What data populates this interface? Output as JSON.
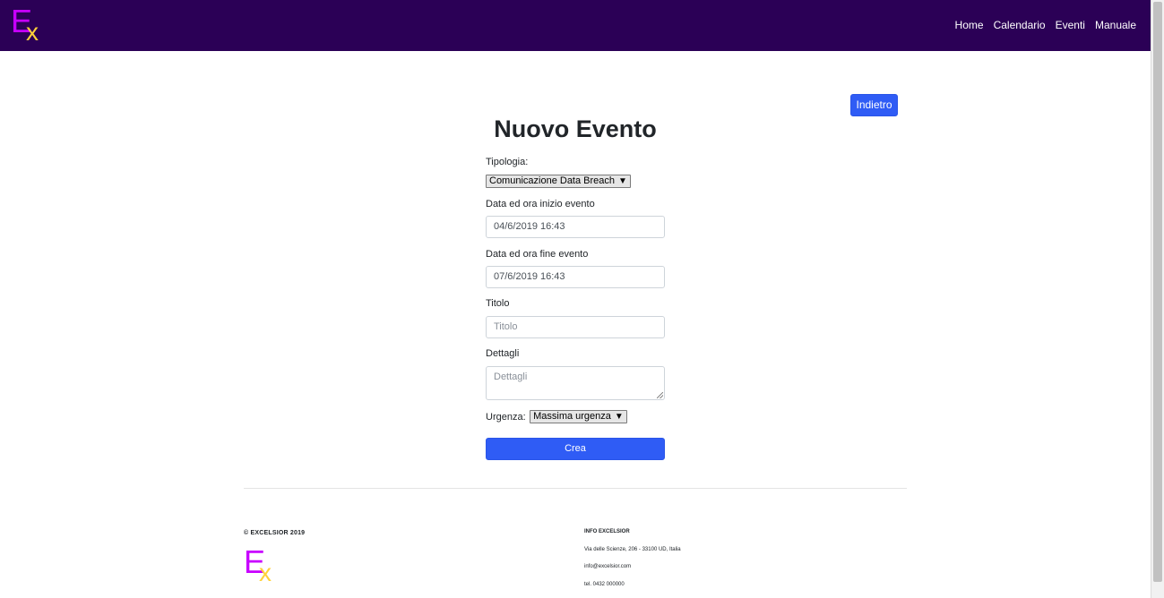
{
  "navbar": {
    "brand": {
      "letter_e": "E",
      "letter_x": "x"
    },
    "links": [
      "Home",
      "Calendario",
      "Eventi",
      "Manuale"
    ]
  },
  "page": {
    "back_label": "Indietro",
    "title": "Nuovo Evento"
  },
  "form": {
    "tipologia_label": "Tipologia:",
    "tipologia_value": "Comunicazione Data Breach",
    "start_label": "Data ed ora inizio evento",
    "start_value": "04/6/2019 16:43",
    "end_label": "Data ed ora fine evento",
    "end_value": "07/6/2019 16:43",
    "titolo_label": "Titolo",
    "titolo_placeholder": "Titolo",
    "dettagli_label": "Dettagli",
    "dettagli_placeholder": "Dettagli",
    "urgenza_label": "Urgenza:",
    "urgenza_value": "Massima urgenza",
    "submit_label": "Crea"
  },
  "footer": {
    "copyright": "© EXCELSIOR 2019",
    "info_title": "INFO EXCELSIOR",
    "address": "Via delle Scienze, 206 - 33100 UD, Italia",
    "email": "info@excelsior.com",
    "phone": "tel. 0432 000000"
  },
  "colors": {
    "navbar": "#2b0056",
    "primary": "#2f5cf5",
    "logo_e": "#c800ff",
    "logo_x": "#ffd23a"
  },
  "icons": {
    "dropdown": "chevron-down-icon",
    "resize": "resize-grip-icon"
  }
}
